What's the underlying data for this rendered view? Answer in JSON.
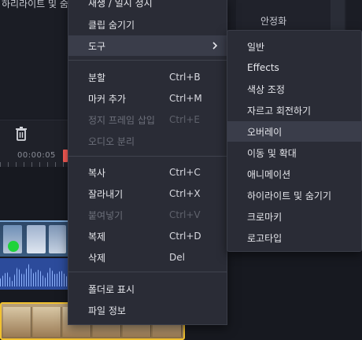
{
  "background": {
    "top_left_text": "하리라이트 및 숨기기",
    "right_panel_label": "안정화",
    "timecode": "00:00:05"
  },
  "context_menu": {
    "items": [
      {
        "label": "재생 / 일시 정지",
        "shortcut": "",
        "disabled": false
      },
      {
        "label": "클립 숨기기",
        "shortcut": "",
        "disabled": false
      },
      {
        "label": "도구",
        "shortcut": "",
        "disabled": false
      },
      {
        "label": "분할",
        "shortcut": "Ctrl+B",
        "disabled": false
      },
      {
        "label": "마커 추가",
        "shortcut": "Ctrl+M",
        "disabled": false
      },
      {
        "label": "정지 프레임 삽입",
        "shortcut": "Ctrl+E",
        "disabled": true
      },
      {
        "label": "오디오 분리",
        "shortcut": "",
        "disabled": true
      },
      {
        "label": "복사",
        "shortcut": "Ctrl+C",
        "disabled": false
      },
      {
        "label": "잘라내기",
        "shortcut": "Ctrl+X",
        "disabled": false
      },
      {
        "label": "붙여넣기",
        "shortcut": "Ctrl+V",
        "disabled": true
      },
      {
        "label": "복제",
        "shortcut": "Ctrl+D",
        "disabled": false
      },
      {
        "label": "삭제",
        "shortcut": "Del",
        "disabled": false
      },
      {
        "label": "폴더로 표시",
        "shortcut": "",
        "disabled": false
      },
      {
        "label": "파일 정보",
        "shortcut": "",
        "disabled": false
      }
    ]
  },
  "tools_submenu": {
    "items": [
      {
        "label": "일반"
      },
      {
        "label": "Effects"
      },
      {
        "label": "색상 조정"
      },
      {
        "label": "자르고 회전하기"
      },
      {
        "label": "오버레이"
      },
      {
        "label": "이동 및 확대"
      },
      {
        "label": "애니메이션"
      },
      {
        "label": "하이라이트 및 숨기기"
      },
      {
        "label": "크로마키"
      },
      {
        "label": "로고타입"
      }
    ],
    "highlighted": "오버레이"
  },
  "colors": {
    "menu_bg": "#2a2c36",
    "highlight": "#3a3d4a",
    "disabled_text": "#6c6f7a",
    "playhead": "#ff5e57",
    "clip_border": "#f2c230"
  },
  "icons": {
    "trash": "trash-icon",
    "submenu_arrow": "chevron-right-icon"
  }
}
